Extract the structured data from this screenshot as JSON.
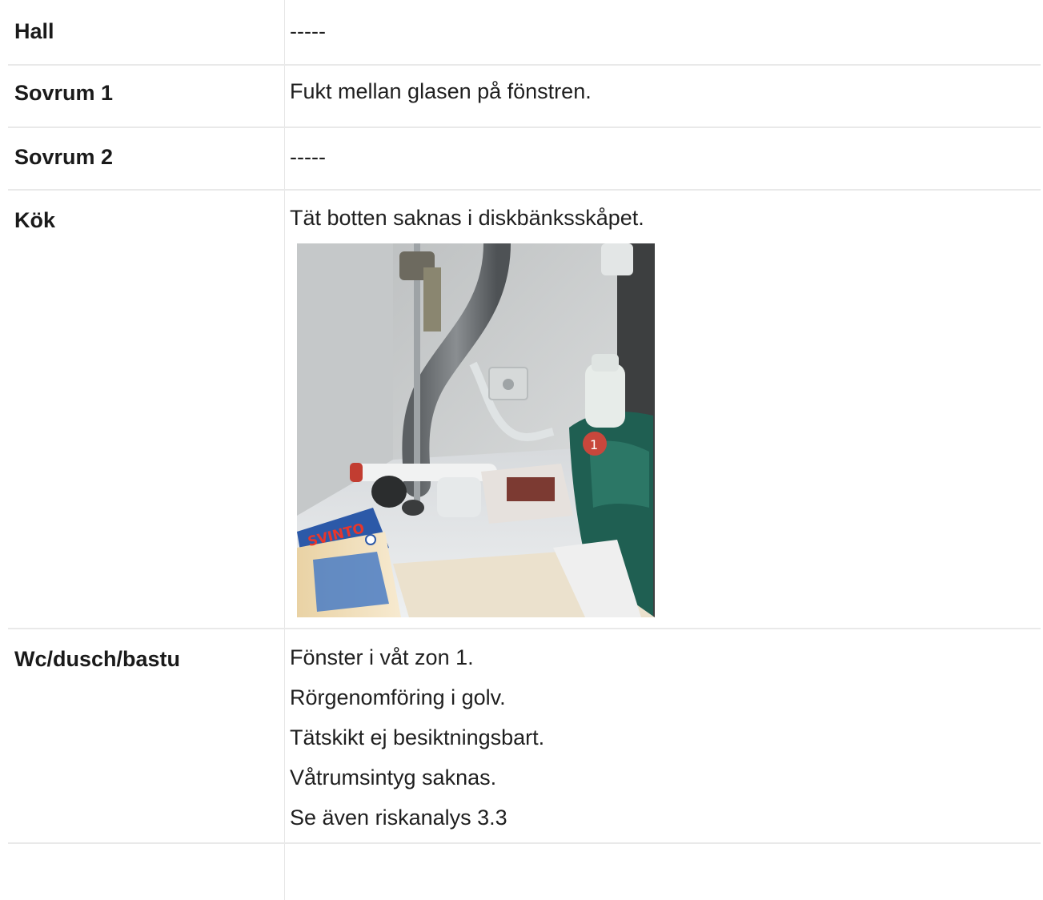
{
  "rows": [
    {
      "room": "Hall",
      "notes": [
        "-----"
      ]
    },
    {
      "room": "Sovrum 1",
      "notes": [
        "Fukt mellan glasen på fönstren."
      ]
    },
    {
      "room": "Sovrum 2",
      "notes": [
        "-----"
      ]
    },
    {
      "room": "Kök",
      "notes": [
        "Tät botten saknas i diskbänksskåpet."
      ]
    },
    {
      "room": "Wc/dusch/bastu",
      "notes": [
        "Fönster i våt zon 1.",
        "Rörgenomföring i golv.",
        "Tätskikt ej besiktningsbart.",
        "Våtrumsintyg saknas.",
        "Se även riskanalys 3.3"
      ]
    }
  ],
  "photo": {
    "product_label": "SVINTO",
    "badge_number": "1"
  },
  "colors": {
    "text": "#1c1c1c",
    "divider": "#e9e9e9"
  }
}
